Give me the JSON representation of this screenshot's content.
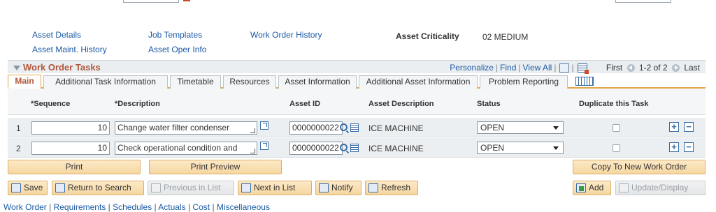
{
  "nav_links": {
    "asset_details": "Asset Details",
    "job_templates": "Job Templates",
    "work_order_history": "Work Order History",
    "asset_maint_history": "Asset Maint. History",
    "asset_oper_info": "Asset Oper Info"
  },
  "asset_criticality": {
    "label": "Asset Criticality",
    "value": "02 MEDIUM"
  },
  "grid": {
    "title": "Work Order Tasks",
    "personalize": "Personalize",
    "find": "Find",
    "view_all": "View All",
    "first": "First",
    "range": "1-2 of 2",
    "last": "Last"
  },
  "tabs": [
    {
      "label": "Main",
      "active": true
    },
    {
      "label": "Additional Task Information"
    },
    {
      "label": "Timetable"
    },
    {
      "label": "Resources"
    },
    {
      "label": "Asset Information"
    },
    {
      "label": "Additional Asset Information"
    },
    {
      "label": "Problem Reporting"
    }
  ],
  "columns": {
    "sequence": "*Sequence",
    "description": "*Description",
    "asset_id": "Asset ID",
    "asset_description": "Asset Description",
    "status": "Status",
    "duplicate": "Duplicate this Task"
  },
  "rows": [
    {
      "num": "1",
      "sequence": "10",
      "description": "Change water filter condenser",
      "asset_id": "0000000022",
      "asset_description": "ICE MACHINE",
      "status": "OPEN",
      "duplicate": false
    },
    {
      "num": "2",
      "sequence": "10",
      "description": "Check operational condition and",
      "asset_id": "0000000022",
      "asset_description": "ICE MACHINE",
      "status": "OPEN",
      "duplicate": false
    }
  ],
  "action_buttons": {
    "print": "Print",
    "print_preview": "Print Preview",
    "copy_to_new": "Copy To New Work Order"
  },
  "toolbar": {
    "save": "Save",
    "return_to_search": "Return to Search",
    "previous_in_list": "Previous in List",
    "next_in_list": "Next in List",
    "notify": "Notify",
    "refresh": "Refresh",
    "add": "Add",
    "update_display": "Update/Display"
  },
  "bottom_links": [
    "Work Order",
    "Requirements",
    "Schedules",
    "Actuals",
    "Cost",
    "Miscellaneous"
  ]
}
